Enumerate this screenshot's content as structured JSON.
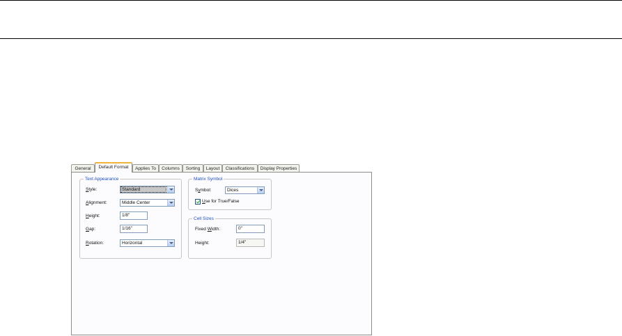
{
  "tabs": [
    {
      "label": "General"
    },
    {
      "label": "Default Format"
    },
    {
      "label": "Applies To"
    },
    {
      "label": "Columns"
    },
    {
      "label": "Sorting"
    },
    {
      "label": "Layout"
    },
    {
      "label": "Classifications"
    },
    {
      "label": "Display Properties"
    }
  ],
  "active_tab": "Default Format",
  "text_appearance": {
    "title": "Text Appearance",
    "style": {
      "label_pre": "",
      "label_key": "S",
      "label_post": "tyle:",
      "value": "Standard"
    },
    "alignment": {
      "label_pre": "",
      "label_key": "A",
      "label_post": "lignment:",
      "value": "Middle Center"
    },
    "height": {
      "label_pre": "",
      "label_key": "H",
      "label_post": "eight:",
      "value": "1/8\""
    },
    "gap": {
      "label_pre": "",
      "label_key": "G",
      "label_post": "ap:",
      "value": "1/16\""
    },
    "rotation": {
      "label_pre": "",
      "label_key": "R",
      "label_post": "otation:",
      "value": "Horizontal"
    }
  },
  "matrix_symbol": {
    "title": "Matrix Symbol",
    "symbol": {
      "label_pre": "S",
      "label_key": "y",
      "label_post": "mbol:",
      "value": "Dices"
    },
    "use_true_false": {
      "label_pre": "",
      "label_key": "U",
      "label_post": "se for True/False",
      "checked": true
    }
  },
  "cell_sizes": {
    "title": "Cell Sizes",
    "fixed_width": {
      "label_pre": "Fixed ",
      "label_key": "W",
      "label_post": "idth:",
      "value": "0\""
    },
    "height": {
      "label": "Height:",
      "value": "1/4\""
    }
  }
}
